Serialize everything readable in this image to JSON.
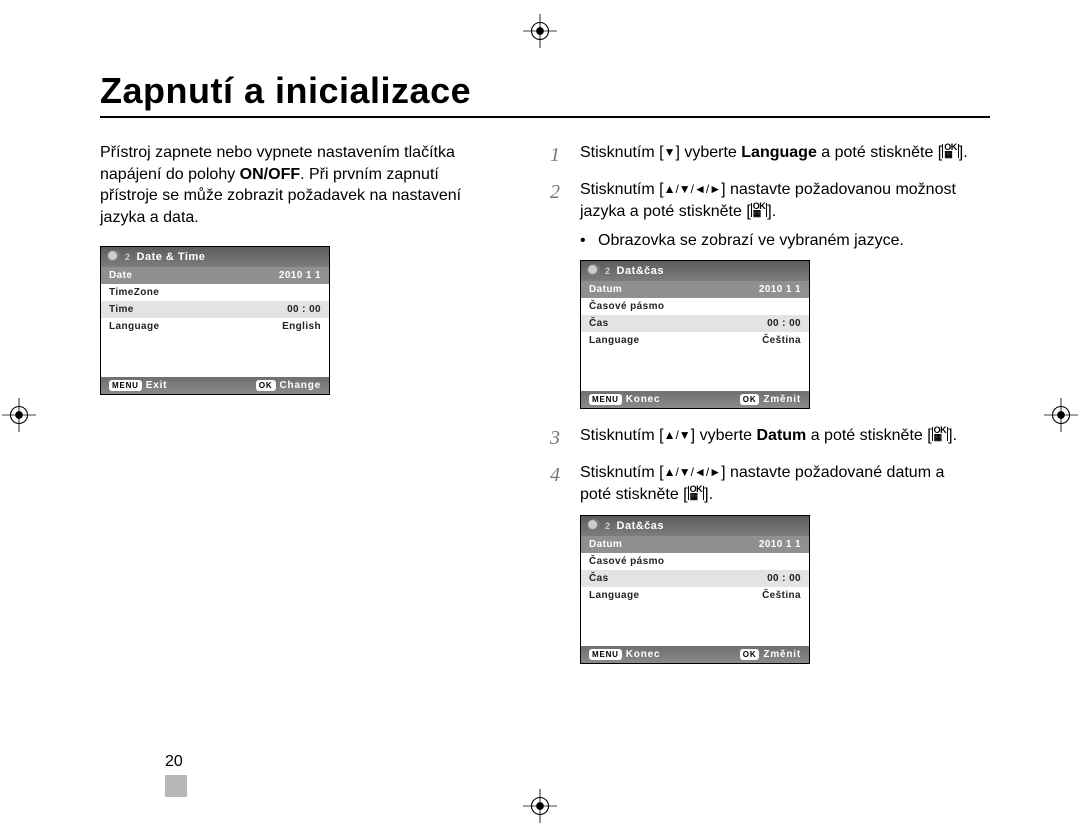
{
  "heading": "Zapnutí a inicializace",
  "intro_before": "Přístroj zapnete nebo vypnete nastavením tlačítka napájení do polohy ",
  "intro_bold": "ON/OFF",
  "intro_after": ". Při prvním zapnutí přístroje se může zobrazit požadavek na nastavení jazyka a data.",
  "steps": {
    "s1": {
      "num": "1",
      "pre": "Stisknutím [",
      "arrows": "▼",
      "mid": "] vyberte ",
      "bold": "Language",
      "post": " a poté stiskněte ["
    },
    "s2": {
      "num": "2",
      "pre": "Stisknutím [",
      "arrows": "▲/▼/◄/►",
      "mid": "] nastavte požadovanou možnost jazyka a poté stiskněte ["
    },
    "s2bullet": "Obrazovka se zobrazí ve vybraném jazyce.",
    "s3": {
      "num": "3",
      "pre": "Stisknutím [",
      "arrows": "▲/▼",
      "mid": "] vyberte ",
      "bold": "Datum",
      "post": " a poté stiskněte ["
    },
    "s4": {
      "num": "4",
      "pre": "Stisknutím [",
      "arrows": "▲/▼/◄/►",
      "mid": "] nastavte požadované datum a poté stiskněte ["
    }
  },
  "menu_en": {
    "title": "Date & Time",
    "rows": [
      {
        "label": "Date",
        "value": "2010 1 1",
        "cls": "hl"
      },
      {
        "label": "TimeZone",
        "value": "",
        "cls": ""
      },
      {
        "label": "Time",
        "value": "00 : 00",
        "cls": "alt"
      },
      {
        "label": "Language",
        "value": "English",
        "cls": ""
      }
    ],
    "footer_left_btn": "MENU",
    "footer_left": "Exit",
    "footer_right_btn": "OK",
    "footer_right": "Change"
  },
  "menu_cz": {
    "title": "Dat&čas",
    "rows": [
      {
        "label": "Datum",
        "value": "2010 1 1",
        "cls": "hl"
      },
      {
        "label": "Časové pásmo",
        "value": "",
        "cls": ""
      },
      {
        "label": "Čas",
        "value": "00 : 00",
        "cls": "alt"
      },
      {
        "label": "Language",
        "value": "Čeština",
        "cls": ""
      }
    ],
    "footer_left_btn": "MENU",
    "footer_left": "Konec",
    "footer_right_btn": "OK",
    "footer_right": "Změnit"
  },
  "page_number": "20",
  "ok_top": "OK",
  "ok_bottom": "▦"
}
